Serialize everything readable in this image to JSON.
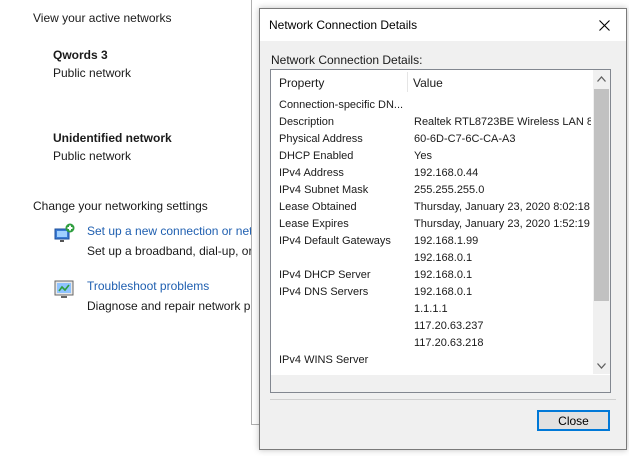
{
  "control_panel": {
    "active_networks_title": "View your active networks",
    "networks": [
      {
        "name": "Qwords 3",
        "type": "Public network"
      },
      {
        "name": "Unidentified network",
        "type": "Public network"
      }
    ],
    "change_settings_title": "Change your networking settings",
    "actions": [
      {
        "link": "Set up a new connection or net",
        "desc": "Set up a broadband, dial-up, or"
      },
      {
        "link": "Troubleshoot problems",
        "desc": "Diagnose and repair network pr"
      }
    ]
  },
  "dialog": {
    "title": "Network Connection Details",
    "section_label": "Network Connection Details:",
    "columns": {
      "property": "Property",
      "value": "Value"
    },
    "rows": [
      {
        "property": "Connection-specific DN...",
        "value": ""
      },
      {
        "property": "Description",
        "value": "Realtek RTL8723BE Wireless LAN 80"
      },
      {
        "property": "Physical Address",
        "value": "60-6D-C7-6C-CA-A3"
      },
      {
        "property": "DHCP Enabled",
        "value": "Yes"
      },
      {
        "property": "IPv4 Address",
        "value": "192.168.0.44"
      },
      {
        "property": "IPv4 Subnet Mask",
        "value": "255.255.255.0"
      },
      {
        "property": "Lease Obtained",
        "value": "Thursday, January 23, 2020 8:02:18 A"
      },
      {
        "property": "Lease Expires",
        "value": "Thursday, January 23, 2020 1:52:19 P"
      },
      {
        "property": "IPv4 Default Gateways",
        "value": "192.168.1.99"
      },
      {
        "property": "",
        "value": "192.168.0.1"
      },
      {
        "property": "IPv4 DHCP Server",
        "value": "192.168.0.1"
      },
      {
        "property": "IPv4 DNS Servers",
        "value": "192.168.0.1"
      },
      {
        "property": "",
        "value": "1.1.1.1"
      },
      {
        "property": "",
        "value": "117.20.63.237"
      },
      {
        "property": "",
        "value": "117.20.63.218"
      },
      {
        "property": "IPv4 WINS Server",
        "value": ""
      }
    ],
    "close_button": "Close"
  }
}
